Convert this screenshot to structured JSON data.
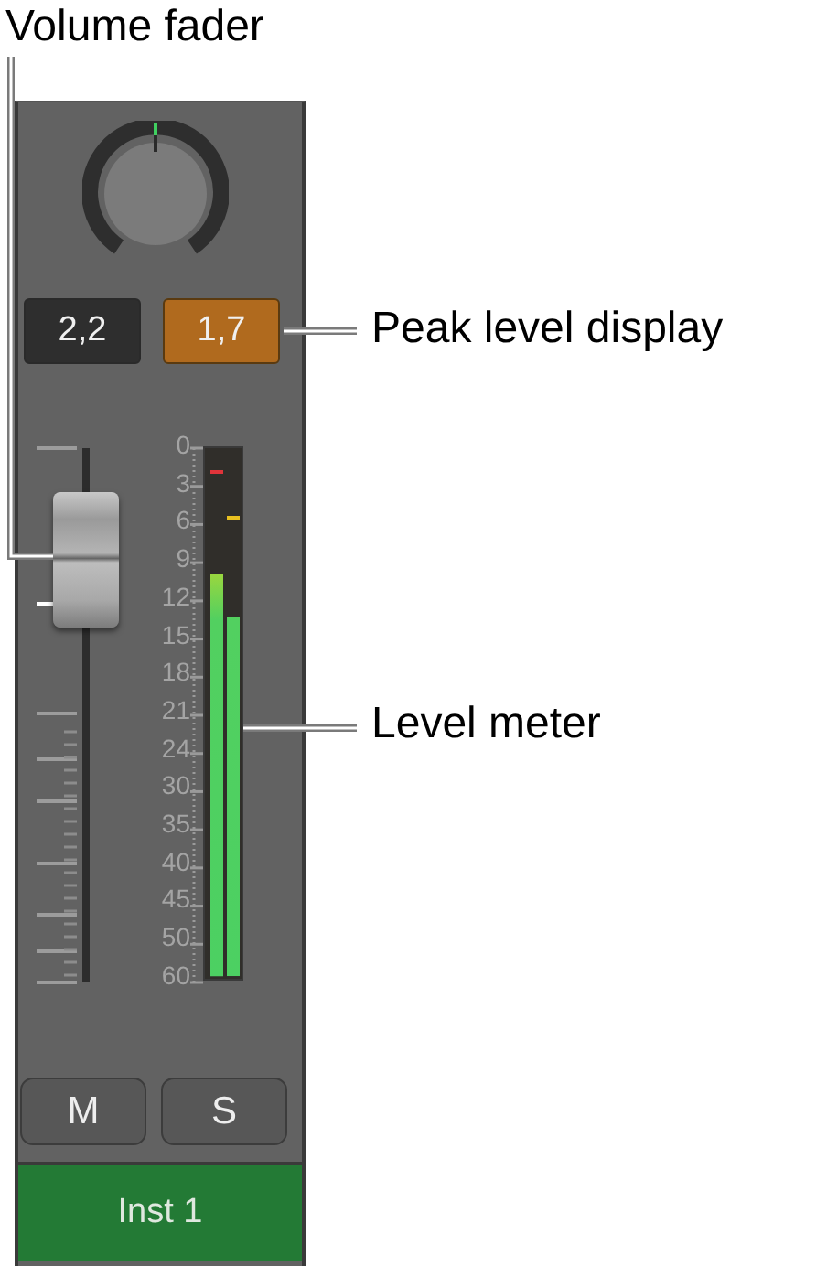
{
  "callouts": [
    {
      "kind": "fader",
      "text": "Volume fader"
    },
    {
      "kind": "peak",
      "text": "Peak level display"
    },
    {
      "kind": "meter",
      "text": "Level meter"
    }
  ],
  "strip": {
    "displays": [
      {
        "text": "2,2",
        "warning": false
      },
      {
        "text": "1,7",
        "warning": true
      }
    ],
    "fader": {
      "level": 0.79
    },
    "meter": {
      "scale": [
        "0",
        "3",
        "6",
        "9",
        "12",
        "15",
        "18",
        "21",
        "24",
        "30",
        "35",
        "40",
        "45",
        "50",
        "60"
      ],
      "channels": [
        {
          "level": 0.76,
          "peak": {
            "level": 0.95,
            "color": "#e0343a"
          }
        },
        {
          "level": 0.68,
          "peak": {
            "level": 0.865,
            "color": "#e8c020"
          }
        }
      ]
    },
    "buttons": [
      {
        "label": "M"
      },
      {
        "label": "S"
      }
    ],
    "name": "Inst 1"
  }
}
